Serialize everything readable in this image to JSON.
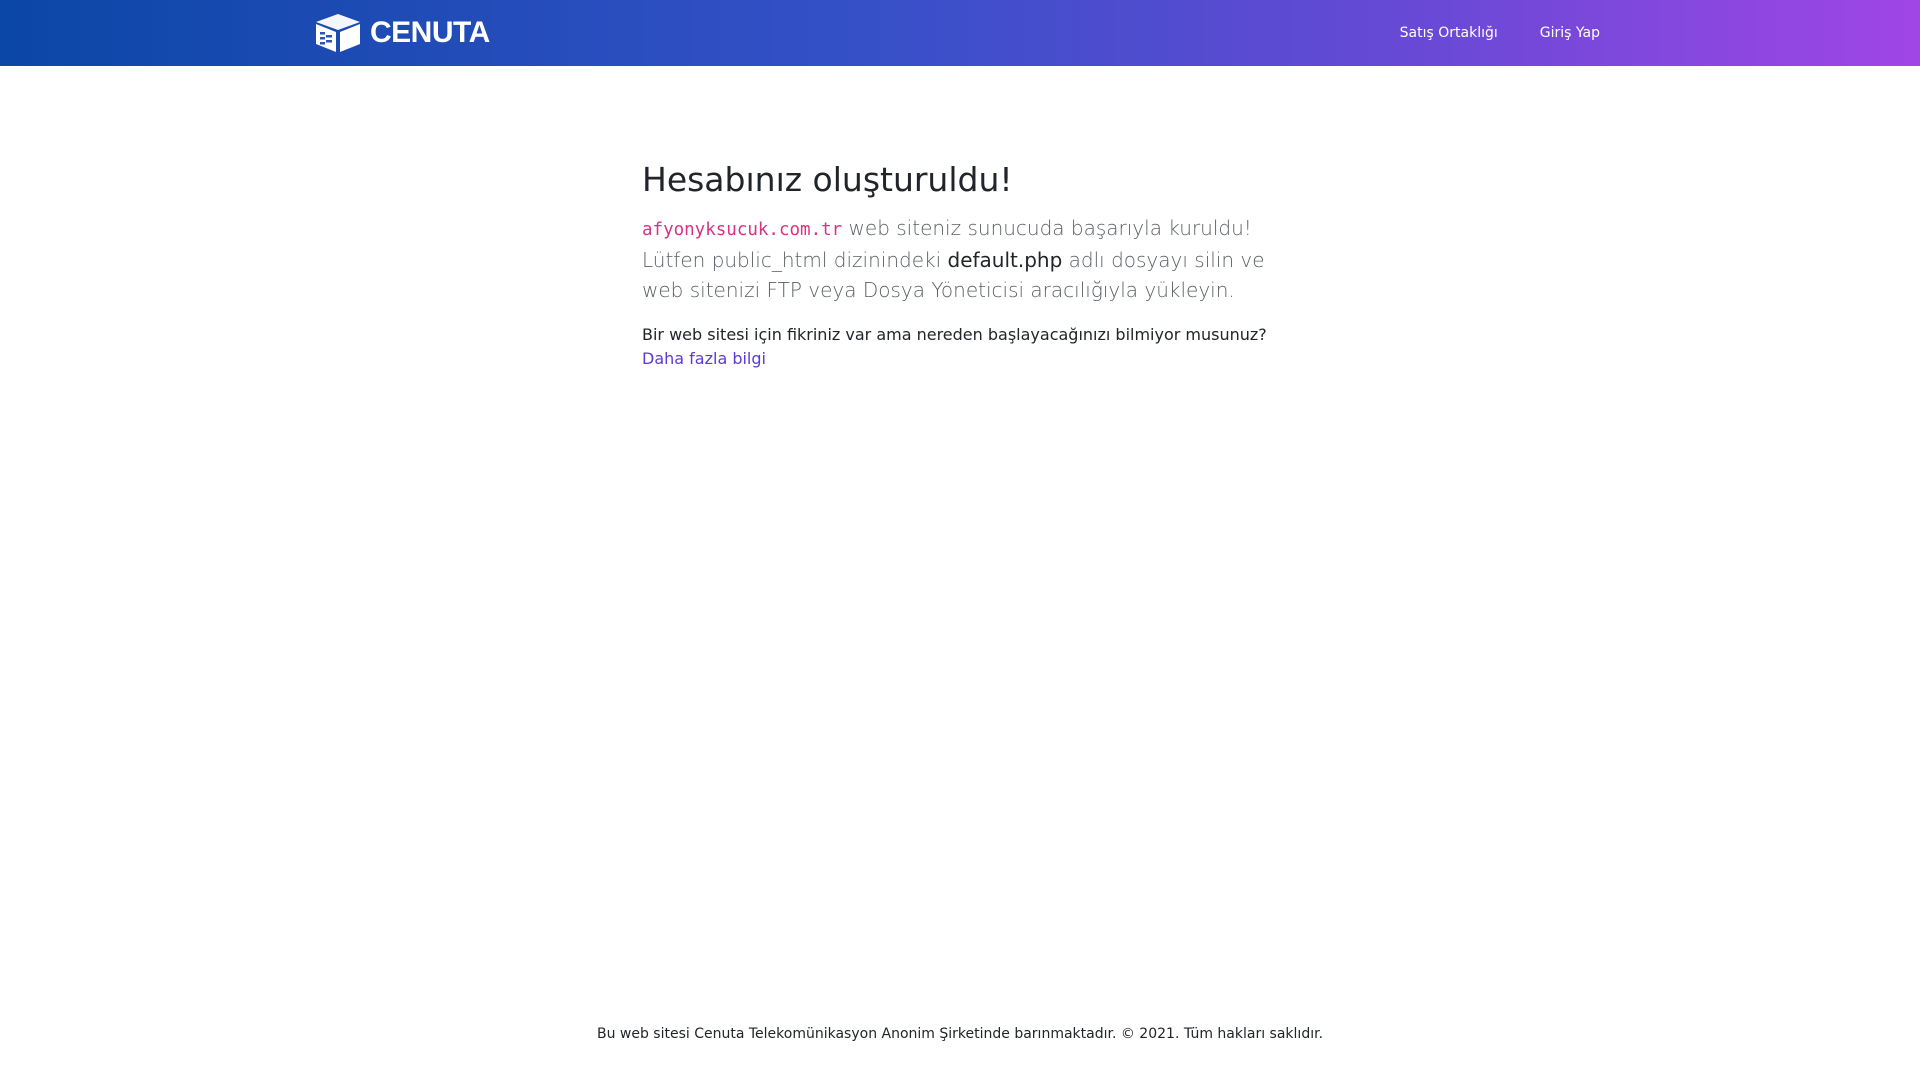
{
  "brand": {
    "name": "CENUTA",
    "logo_icon": "box-icon"
  },
  "nav": {
    "items": [
      {
        "label": "Satış Ortaklığı",
        "icon": "handshake-icon"
      },
      {
        "label": "Giriş Yap",
        "icon": "sign-in-icon"
      }
    ]
  },
  "main": {
    "title": "Hesabınız oluşturuldu!",
    "domain": "afyonyksucuk.com.tr",
    "lead_part1": " web siteniz sunucuda başarıyla kuruldu! Lütfen public_html dizinindeki ",
    "file": "default.php",
    "lead_part2": " adlı dosyayı silin ve web sitenizi FTP veya Dosya Yöneticisi aracılığıyla yükleyin.",
    "question": "Bir web sitesi için fikriniz var ama nereden başlayacağınızı bilmiyor musunuz?",
    "more_link": "Daha fazla bilgi",
    "more_icon": "arrow-right-icon"
  },
  "footer": {
    "text": "Bu web sitesi Cenuta Telekomünikasyon Anonim Şirketinde barınmaktadır. © 2021. Tüm hakları saklıdır."
  },
  "colors": {
    "navbar_start": "#0b47a6",
    "navbar_end": "#a046e6",
    "domain_code": "#d63384",
    "link": "#5b3bd1"
  }
}
